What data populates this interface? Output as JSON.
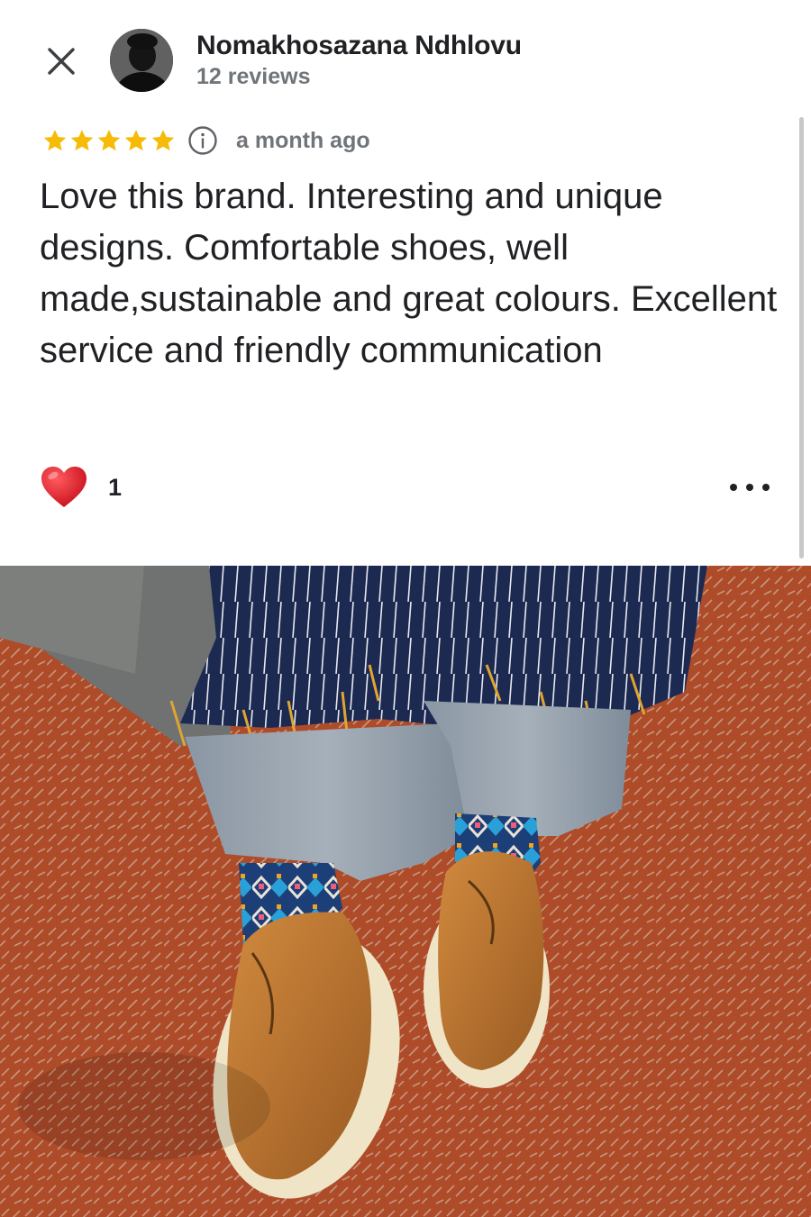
{
  "reviewer": {
    "name": "Nomakhosazana Ndhlovu",
    "review_count": "12 reviews"
  },
  "review": {
    "rating": 5,
    "time_ago": "a month ago",
    "text": "Love this brand. Interesting and unique designs. Comfortable shoes, well made,sustainable and great colours. Excellent service and friendly communication",
    "likes": "1"
  },
  "icons": {
    "close": "close-icon",
    "star": "star-icon",
    "info": "info-icon",
    "heart": "heart-icon",
    "more": "more-options-icon"
  },
  "colors": {
    "star": "#f6bb06",
    "heart": "#e0242e",
    "text_primary": "#202124",
    "text_secondary": "#70757a"
  },
  "photo": {
    "subject": "review-photo"
  }
}
